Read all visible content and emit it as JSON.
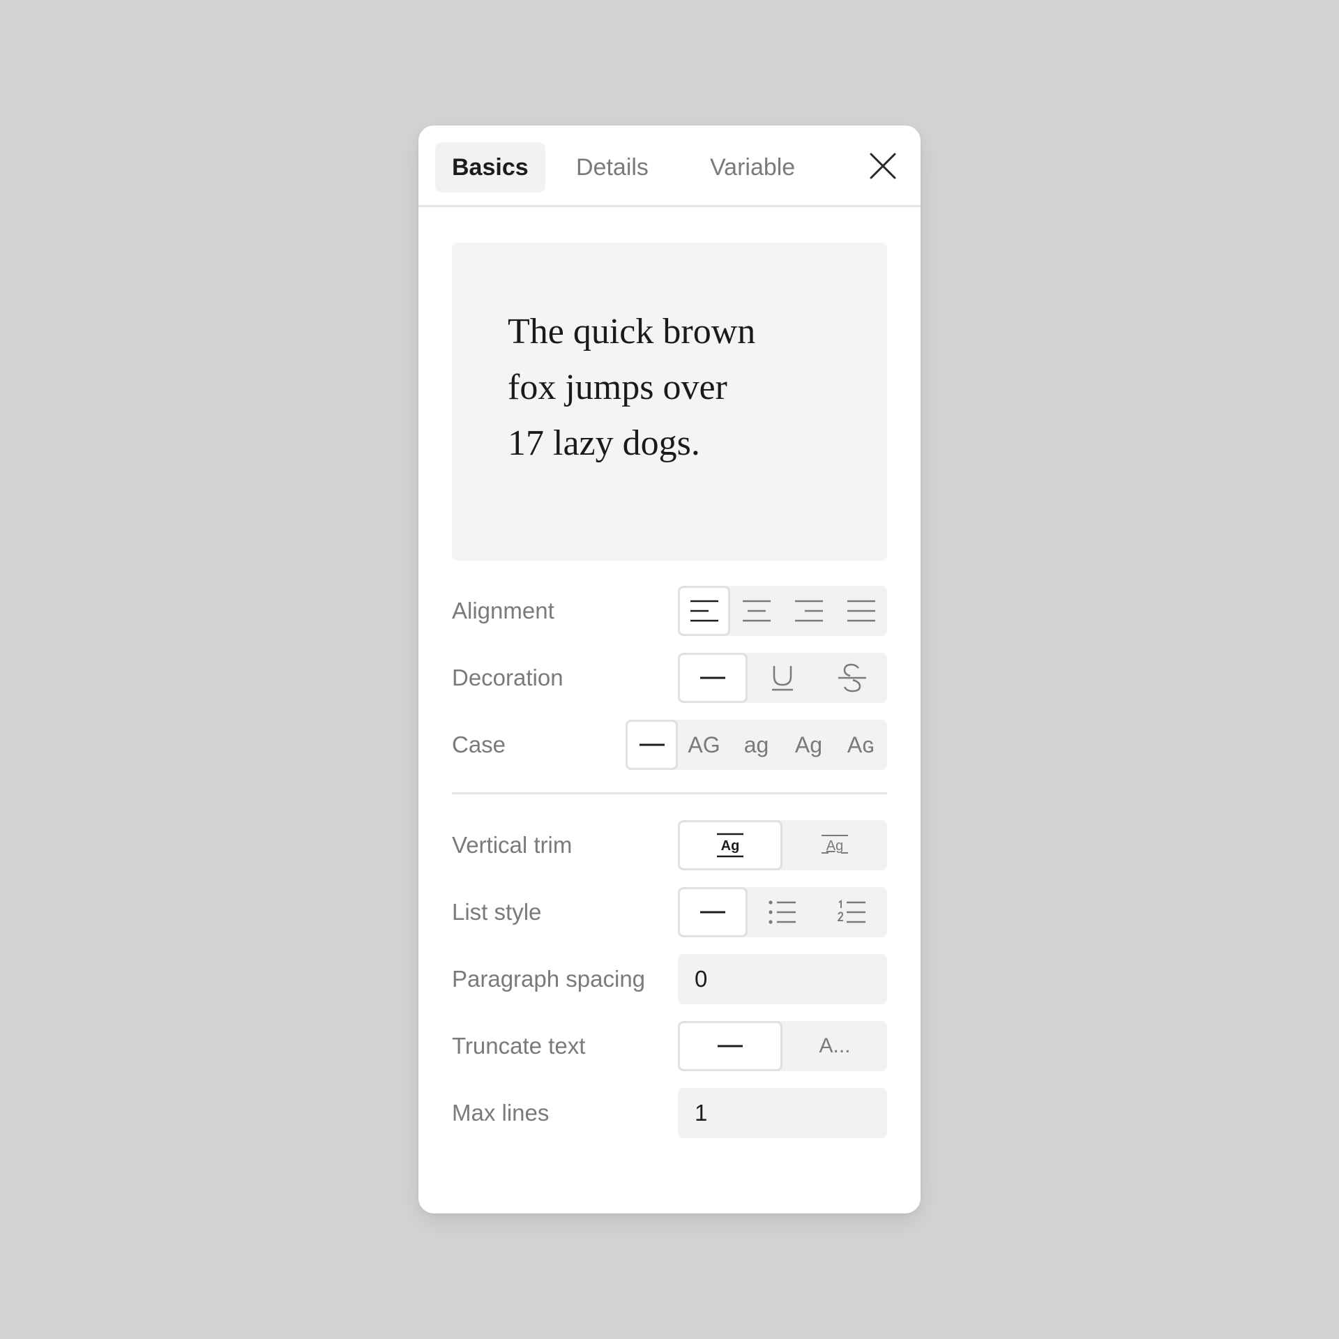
{
  "tabs": [
    {
      "label": "Basics",
      "active": true
    },
    {
      "label": "Details",
      "active": false
    },
    {
      "label": "Variable",
      "active": false
    }
  ],
  "preview": {
    "lines": [
      "The quick brown",
      "fox jumps over",
      "17 lazy dogs."
    ]
  },
  "alignment": {
    "label": "Alignment",
    "options": [
      "align-left-icon",
      "align-center-icon",
      "align-right-icon",
      "align-justify-icon"
    ],
    "selected": "align-left-icon"
  },
  "decoration": {
    "label": "Decoration",
    "options": [
      "none-dash-icon",
      "underline-icon",
      "strikethrough-icon"
    ],
    "selected": "none-dash-icon"
  },
  "case": {
    "label": "Case",
    "none_icon": "none-dash-icon",
    "options": [
      "AG",
      "ag",
      "Ag",
      "Aɢ"
    ],
    "selected": "none"
  },
  "vertical_trim": {
    "label": "Vertical trim",
    "options": [
      {
        "icon": "trim-cap-height-icon",
        "text": "Ag"
      },
      {
        "icon": "trim-standard-icon",
        "text": "Ag"
      }
    ],
    "selected": 0
  },
  "list_style": {
    "label": "List style",
    "options": [
      "none-dash-icon",
      "bulleted-list-icon",
      "numbered-list-icon"
    ],
    "selected": "none-dash-icon"
  },
  "paragraph_spacing": {
    "label": "Paragraph spacing",
    "value": "0"
  },
  "truncate_text": {
    "label": "Truncate text",
    "none_icon": "none-dash-icon",
    "ellipsis": "A...",
    "selected": "none"
  },
  "max_lines": {
    "label": "Max lines",
    "value": "1"
  },
  "colors": {
    "background": "#d4d4d4",
    "panel": "#ffffff",
    "control_bg": "#f2f2f2",
    "text_primary": "#1c1c1c",
    "text_secondary": "#7a7a7a"
  }
}
